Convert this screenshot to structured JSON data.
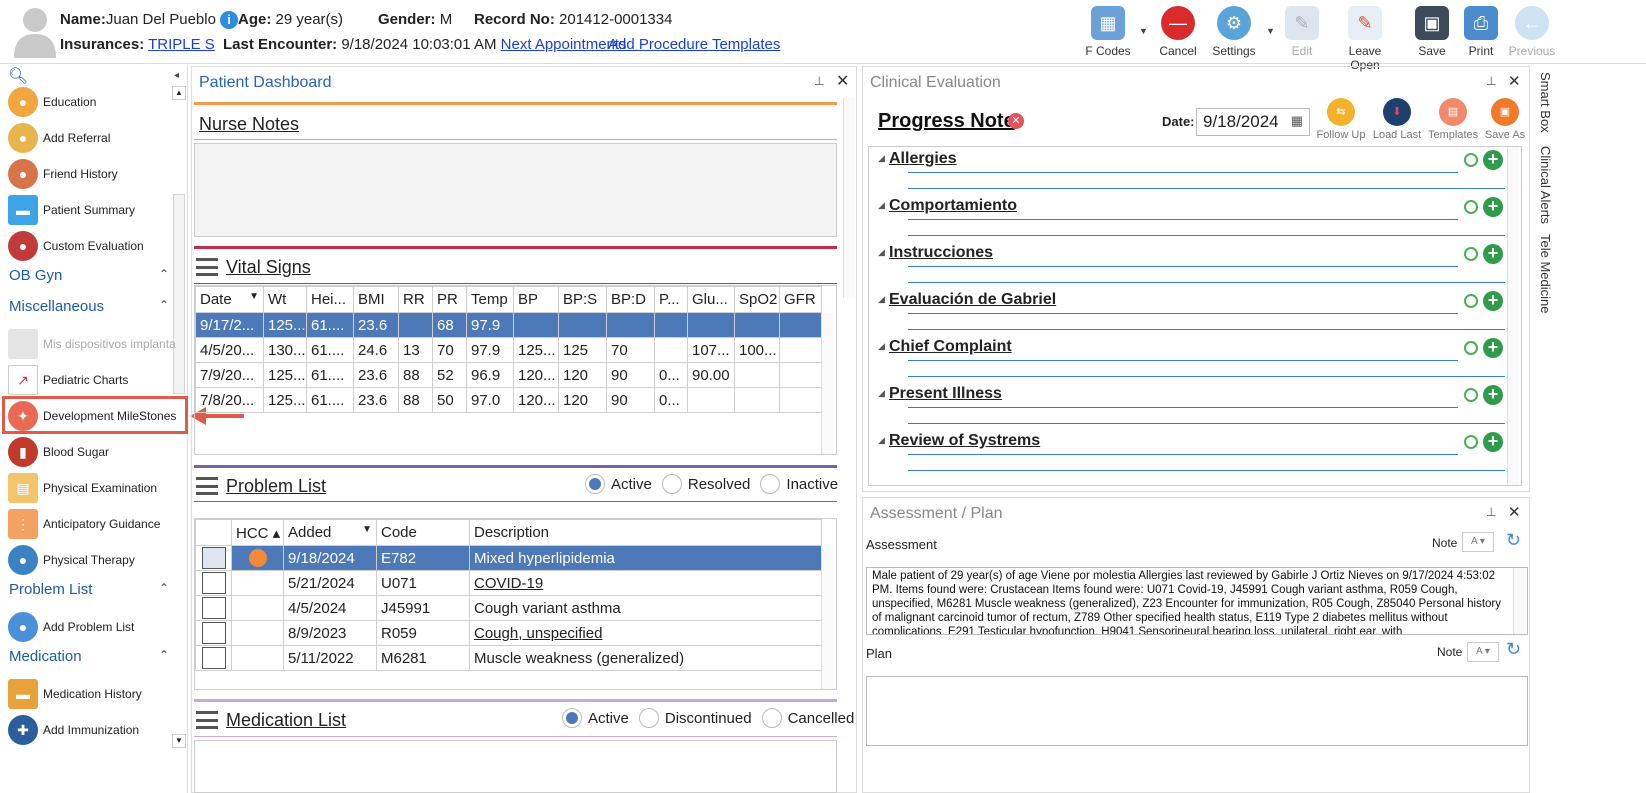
{
  "patient": {
    "name_label": "Name:",
    "name": "Juan Del Pueblo",
    "age_label": "Age:",
    "age": "29 year(s)",
    "gender_label": "Gender:",
    "gender": "M",
    "record_label": "Record No:",
    "record": "201412-0001334",
    "insurances_label": "Insurances:",
    "insurance": "TRIPLE S",
    "last_label": "Last Encounter:",
    "last_encounter": "9/18/2024 10:03:01 AM",
    "next_appointments": "Next Appointments",
    "add_templates": "Add Procedure Templates"
  },
  "toolbar": {
    "fcodes": "F Codes",
    "cancel": "Cancel",
    "settings": "Settings",
    "edit": "Edit",
    "leave_open": "Leave Open",
    "save": "Save",
    "print": "Print",
    "previous": "Previous"
  },
  "sidebar": {
    "items_top": [
      "Education",
      "Add Referral",
      "Friend History",
      "Patient Summary",
      "Custom Evaluation"
    ],
    "sec_obgyn": "OB Gyn",
    "sec_misc": "Miscellaneous",
    "items_misc": [
      "Mis dispositivos implanta",
      "Pediatric Charts",
      "Development MileStones",
      "Blood Sugar",
      "Physical Examination",
      "Anticipatory Guidance",
      "Physical Therapy"
    ],
    "sec_problem": "Problem List",
    "item_add_problem": "Add Problem List",
    "sec_med": "Medication",
    "items_med": [
      "Medication History",
      "Add Immunization"
    ]
  },
  "dashboard": {
    "title": "Patient Dashboard",
    "nurse_notes": "Nurse Notes",
    "vital_signs": "Vital Signs",
    "vital_cols": [
      "Date",
      "Wt",
      "Hei...",
      "BMI",
      "RR",
      "PR",
      "Temp",
      "BP",
      "BP:S",
      "BP:D",
      "P...",
      "Glu...",
      "SpO2",
      "GFR"
    ],
    "vital_rows": [
      [
        "9/17/2...",
        "125...",
        "61....",
        "23.6",
        "",
        "68",
        "97.9",
        "",
        "",
        "",
        "",
        "",
        "",
        ""
      ],
      [
        "4/5/20...",
        "130...",
        "61....",
        "24.6",
        "13",
        "70",
        "97.9",
        "125...",
        "125",
        "70",
        "",
        "107...",
        "100...",
        ""
      ],
      [
        "7/9/20...",
        "125...",
        "61....",
        "23.6",
        "88",
        "52",
        "96.9",
        "120...",
        "120",
        "90",
        "0...",
        "90.00",
        "",
        ""
      ],
      [
        "7/8/20...",
        "125...",
        "61....",
        "23.6",
        "88",
        "50",
        "97.0",
        "120...",
        "120",
        "90",
        "0...",
        "",
        "",
        ""
      ]
    ],
    "problem_list": "Problem List",
    "radio_active": "Active",
    "radio_resolved": "Resolved",
    "radio_inactive": "Inactive",
    "problem_cols": [
      "HCC",
      "Added",
      "Code",
      "Description"
    ],
    "problem_rows": [
      [
        "9/18/2024",
        "E782",
        "Mixed hyperlipidemia"
      ],
      [
        "5/21/2024",
        "U071",
        "COVID-19"
      ],
      [
        "4/5/2024",
        "J45991",
        "Cough variant asthma"
      ],
      [
        "8/9/2023",
        "R059",
        "Cough, unspecified"
      ],
      [
        "5/11/2022",
        "M6281",
        "Muscle weakness (generalized)"
      ]
    ],
    "medication_list": "Medication List",
    "med_active": "Active",
    "med_discontinued": "Discontinued",
    "med_cancelled": "Cancelled"
  },
  "clinical": {
    "title": "Clinical Evaluation",
    "note_title": "Progress Note",
    "date_label": "Date:",
    "date": "9/18/2024",
    "actions": [
      "Follow Up",
      "Load Last",
      "Templates",
      "Save As"
    ],
    "sections": [
      "Allergies",
      "Comportamiento",
      "Instrucciones",
      "Evaluación de Gabriel",
      "Chief Complaint",
      "Present Illness",
      "Review of Systrems"
    ]
  },
  "assessment": {
    "title": "Assessment / Plan",
    "assessment_label": "Assessment",
    "note_label": "Note",
    "plan_label": "Plan",
    "plan_note_label": "Note",
    "text": "Male patient of 29 year(s) of age Viene por molestia     Allergies last reviewed by Gabirle J Ortiz Nieves on 9/17/2024 4:53:02 PM.    Items found were:  Crustacean  Items found were:  U071 Covid-19, J45991 Cough variant asthma, R059 Cough, unspecified, M6281 Muscle weakness (generalized), Z23 Encounter for immunization, R05 Cough, Z85040 Personal history of malignant carcinoid tumor of rectum, Z789 Other specified health status, E119 Type 2 diabetes mellitus without complications, E291 Testicular hypofunction, H9041 Sensorineural hearing loss, unilateral, right ear, with"
  },
  "right_tabs": [
    "Smart Box",
    "Clinical Alerts",
    "Tele Medicine"
  ]
}
